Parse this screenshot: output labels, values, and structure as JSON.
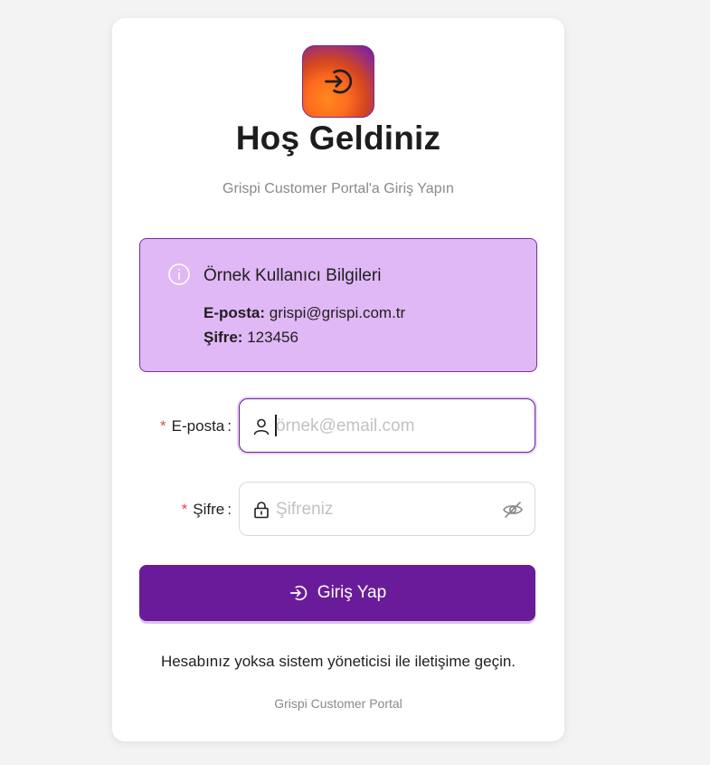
{
  "header": {
    "title": "Hoş Geldiniz",
    "subtitle": "Grispi Customer Portal'a Giriş Yapın",
    "logo_icon": "login-icon"
  },
  "info": {
    "title": "Örnek Kullanıcı Bilgileri",
    "email_label": "E-posta:",
    "email_value": "grispi@grispi.com.tr",
    "password_label": "Şifre:",
    "password_value": "123456",
    "icon": "info-icon"
  },
  "form": {
    "email": {
      "label": "E-posta",
      "required_mark": "*",
      "colon": ":",
      "placeholder": "örnek@email.com",
      "icon": "user-icon"
    },
    "password": {
      "label": "Şifre",
      "required_mark": "*",
      "colon": ":",
      "placeholder": "Şifreniz",
      "icon": "lock-icon",
      "toggle_icon": "eye-off-icon"
    },
    "submit_label": "Giriş Yap"
  },
  "help_text": "Hesabınız yoksa sistem yöneticisi ile iletişime geçin.",
  "footer_text": "Grispi Customer Portal",
  "colors": {
    "primary": "#6a1b9a",
    "info_bg": "#dfb8f5",
    "required": "#e0455a",
    "page_bg": "#f3f3f3"
  }
}
